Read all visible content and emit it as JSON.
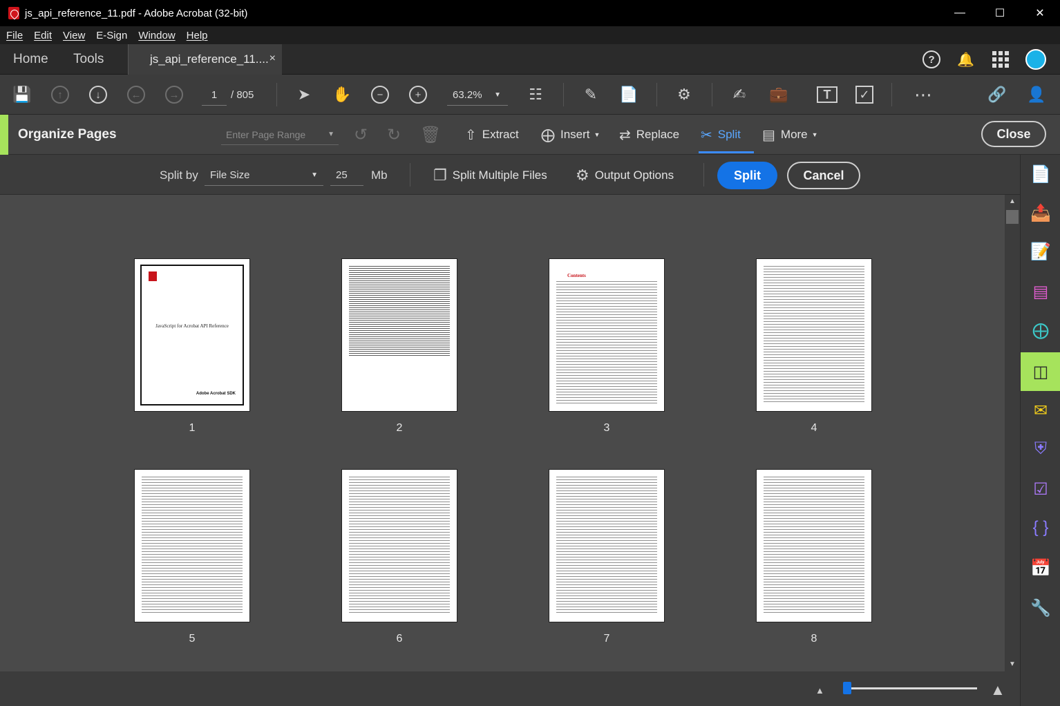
{
  "window": {
    "title": "js_api_reference_11.pdf - Adobe Acrobat (32-bit)"
  },
  "menu": [
    "File",
    "Edit",
    "View",
    "E-Sign",
    "Window",
    "Help"
  ],
  "tabs": {
    "home": "Home",
    "tools": "Tools",
    "document": "js_api_reference_11....",
    "close_glyph": "×"
  },
  "toolbar": {
    "page_current": "1",
    "page_total": "/  805",
    "zoom": "63.2%"
  },
  "organize": {
    "title": "Organize Pages",
    "range_placeholder": "Enter Page Range",
    "extract": "Extract",
    "insert": "Insert",
    "replace": "Replace",
    "split": "Split",
    "more": "More",
    "close": "Close"
  },
  "split_options": {
    "split_by_label": "Split by",
    "split_by_value": "File Size",
    "size_value": "25",
    "size_unit": "Mb",
    "split_multiple_files": "Split Multiple Files",
    "output_options": "Output Options",
    "split_button": "Split",
    "cancel_button": "Cancel"
  },
  "thumbnails": [
    {
      "label": "1",
      "kind": "cover",
      "cover_title": "JavaScript for Acrobat API Reference",
      "cover_footer": "Adobe Acrobat SDK"
    },
    {
      "label": "2",
      "kind": "text"
    },
    {
      "label": "3",
      "kind": "toc",
      "toc_title": "Contents"
    },
    {
      "label": "4",
      "kind": "toc"
    },
    {
      "label": "5",
      "kind": "toc"
    },
    {
      "label": "6",
      "kind": "toc"
    },
    {
      "label": "7",
      "kind": "toc"
    },
    {
      "label": "8",
      "kind": "toc"
    }
  ],
  "zoom_slider": {
    "level": 0.03
  },
  "colors": {
    "accent_blue": "#1473e6",
    "organize_green": "#a6e35c",
    "pdf_red": "#d0141b"
  },
  "icons": {
    "toolbar": [
      "save-icon",
      "prev-page-icon",
      "next-page-icon",
      "back-icon",
      "forward-icon",
      "select-arrow-icon",
      "hand-tool-icon",
      "zoom-out-icon",
      "zoom-in-icon",
      "scroll-mode-icon",
      "fill-sign-icon",
      "edit-pdf-icon",
      "scan-icon",
      "edit-text-icon",
      "tools-briefcase-icon",
      "text-field-icon",
      "checkbox-icon",
      "more-icon",
      "share-link-icon",
      "add-user-icon"
    ],
    "rail": [
      "create-pdf-icon",
      "export-pdf-icon",
      "edit-pdf-icon",
      "organize-icon",
      "create-pdf-plus-icon",
      "organize-pages-icon",
      "comment-icon",
      "protect-icon",
      "checklist-icon",
      "rich-media-icon",
      "calendar-icon",
      "more-tools-icon"
    ]
  }
}
